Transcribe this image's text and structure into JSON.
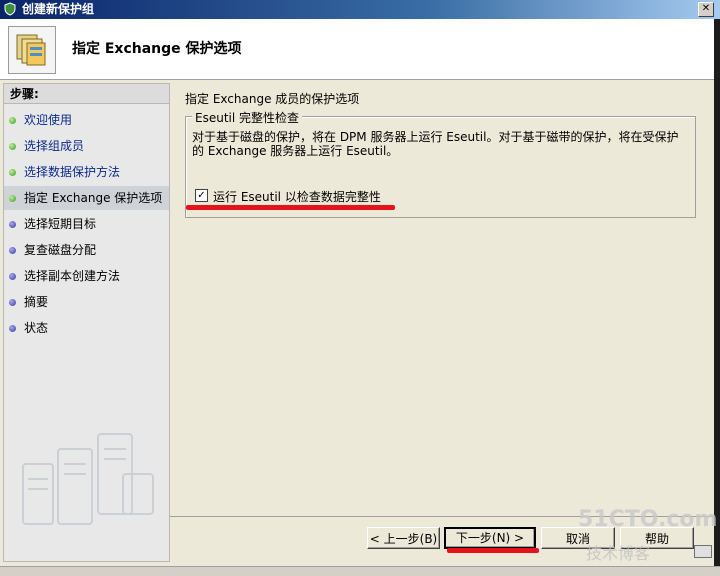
{
  "window": {
    "title": "创建新保护组"
  },
  "header": {
    "title": "指定 Exchange 保护选项"
  },
  "sidebar": {
    "steps_label": "步骤:",
    "items": [
      {
        "label": "欢迎使用",
        "state": "done"
      },
      {
        "label": "选择组成员",
        "state": "done"
      },
      {
        "label": "选择数据保护方法",
        "state": "done"
      },
      {
        "label": "指定 Exchange 保护选项",
        "state": "current"
      },
      {
        "label": "选择短期目标",
        "state": "pending"
      },
      {
        "label": "复查磁盘分配",
        "state": "pending"
      },
      {
        "label": "选择副本创建方法",
        "state": "pending"
      },
      {
        "label": "摘要",
        "state": "pending"
      },
      {
        "label": "状态",
        "state": "pending"
      }
    ]
  },
  "main": {
    "section_title": "指定 Exchange 成员的保护选项",
    "group": {
      "legend": "Eseutil 完整性检查",
      "description": "对于基于磁盘的保护，将在 DPM 服务器上运行 Eseutil。对于基于磁带的保护，将在受保护的 Exchange 服务器上运行 Eseutil。",
      "checkbox_label": "运行 Eseutil 以检查数据完整性",
      "checkbox_checked": true,
      "check_glyph": "✓"
    }
  },
  "buttons": {
    "back": "< 上一步(B)",
    "next": "下一步(N) >",
    "cancel": "取消",
    "help": "帮助"
  },
  "watermark": {
    "line1": "51CTO.com",
    "line2": "技术博客"
  },
  "colors": {
    "annotation_red": "#e8121b",
    "title_bar": "#0a246a"
  }
}
